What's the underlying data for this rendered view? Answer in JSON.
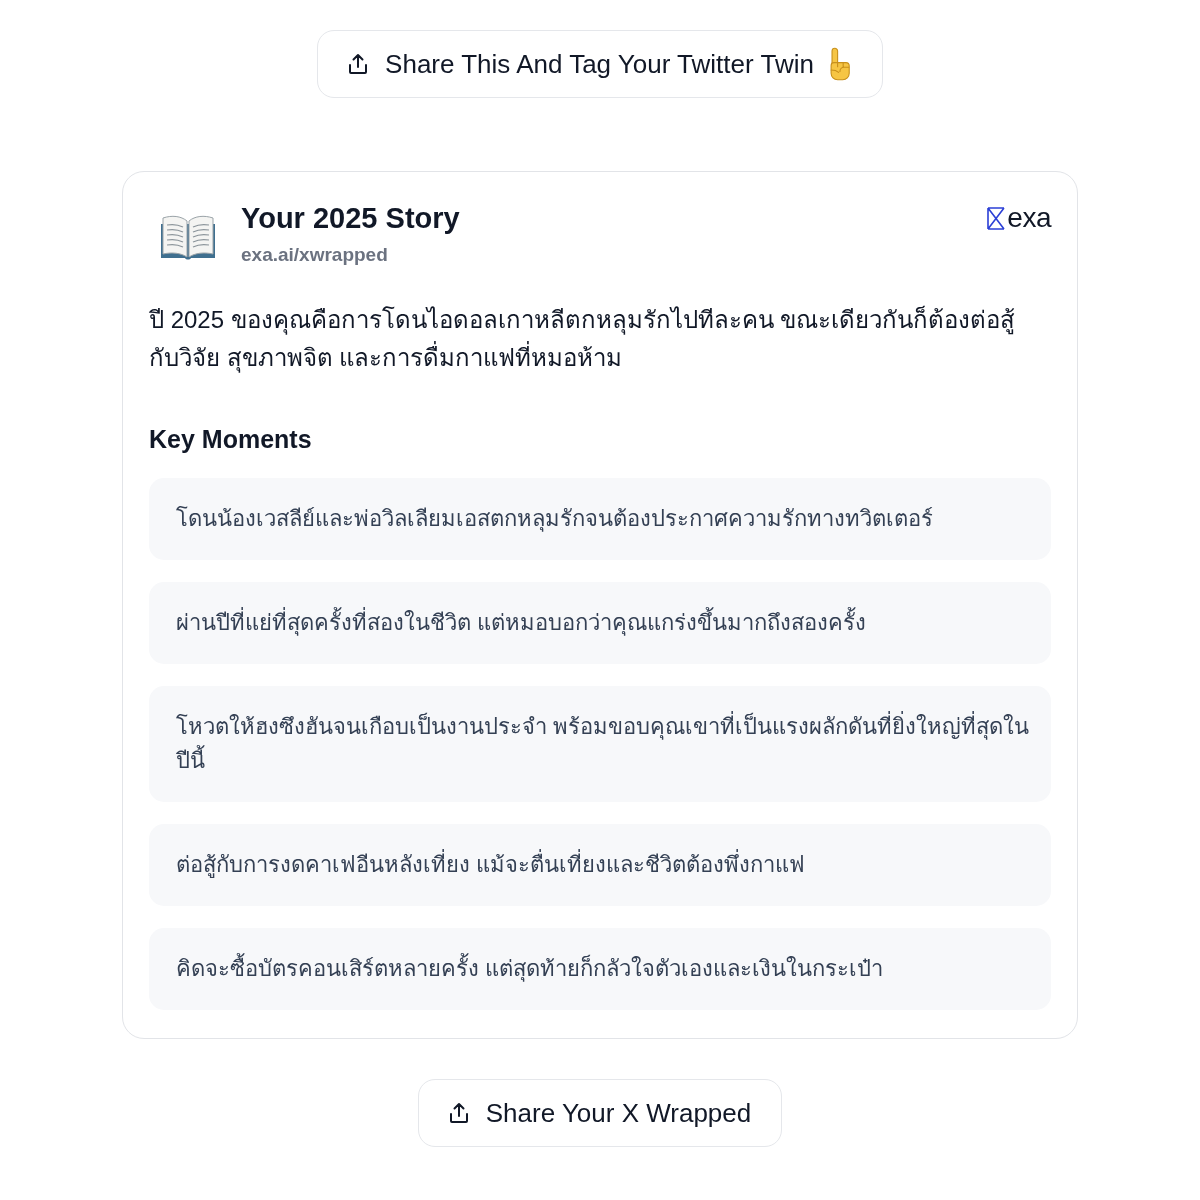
{
  "share_top": {
    "label": "Share This And Tag Your Twitter Twin"
  },
  "card": {
    "title": "Your 2025 Story",
    "subtitle": "exa.ai/xwrapped",
    "brand": "exa",
    "summary": "ปี 2025 ของคุณคือการโดนไอดอลเกาหลีตกหลุมรักไปทีละคน ขณะเดียวกันก็ต้องต่อสู้กับวิจัย สุขภาพจิต และการดื่มกาแฟที่หมอห้าม",
    "section_title": "Key Moments",
    "moments": [
      "โดนน้องเวสลีย์และพ่อวิลเลียมเอสตกหลุมรักจนต้องประกาศความรักทางทวิตเตอร์",
      "ผ่านปีที่แย่ที่สุดครั้งที่สองในชีวิต แต่หมอบอกว่าคุณแกร่งขึ้นมากถึงสองครั้ง",
      "โหวตให้ฮงซึงฮันจนเกือบเป็นงานประจำ พร้อมขอบคุณเขาที่เป็นแรงผลักดันที่ยิ่งใหญ่ที่สุดในปีนี้",
      "ต่อสู้กับการงดคาเฟอีนหลังเที่ยง แม้จะตื่นเที่ยงและชีวิตต้องพึ่งกาแฟ",
      "คิดจะซื้อบัตรคอนเสิร์ตหลายครั้ง แต่สุดท้ายก็กลัวใจตัวเองและเงินในกระเป๋า"
    ]
  },
  "share_bottom": {
    "label": "Share Your X Wrapped"
  }
}
